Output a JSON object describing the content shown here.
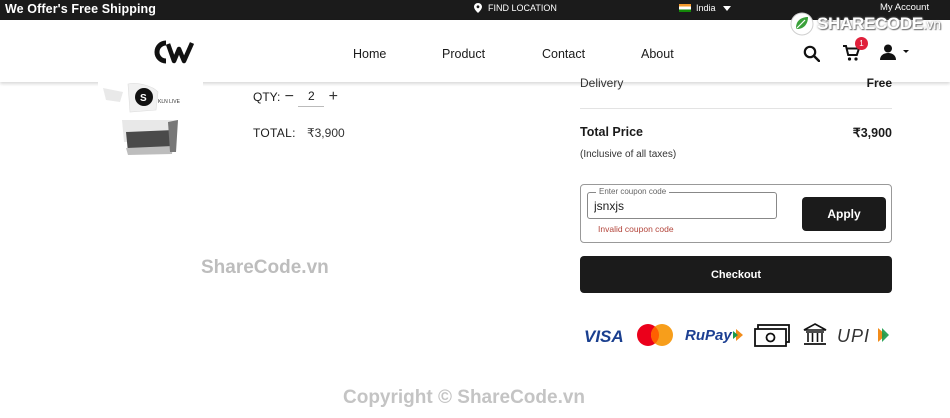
{
  "topbar": {
    "offer": "We Offer's Free Shipping",
    "location": "FIND LOCATION",
    "country": "India",
    "account": "My Account"
  },
  "nav": {
    "items": [
      "Home",
      "Product",
      "Contact",
      "About"
    ],
    "cart_count": "1"
  },
  "brand": {
    "sharecode_name": "SHARECODE",
    "sharecode_tld": ".vn"
  },
  "cart_item": {
    "qty_label": "QTY:",
    "qty_value": "2",
    "total_label": "TOTAL:",
    "total_value": "₹3,900"
  },
  "summary": {
    "delivery_label": "Delivery",
    "delivery_value": "Free",
    "total_price_label": "Total Price",
    "total_price_value": "₹3,900",
    "tax_note": "(Inclusive of all taxes)"
  },
  "coupon": {
    "label": "Enter coupon code",
    "value": "jsnxjs",
    "error": "Invalid coupon code",
    "apply_label": "Apply"
  },
  "checkout": {
    "label": "Checkout"
  },
  "payments": {
    "visa": "VISA",
    "rupay": "RuPay",
    "upi": "UPI"
  },
  "watermarks": {
    "center": "ShareCode.vn",
    "footer": "Copyright © ShareCode.vn"
  },
  "colors": {
    "dark": "#1b1b1b",
    "badge": "#e0203b",
    "error": "#b3453b",
    "brand_green": "#3aa13a"
  }
}
